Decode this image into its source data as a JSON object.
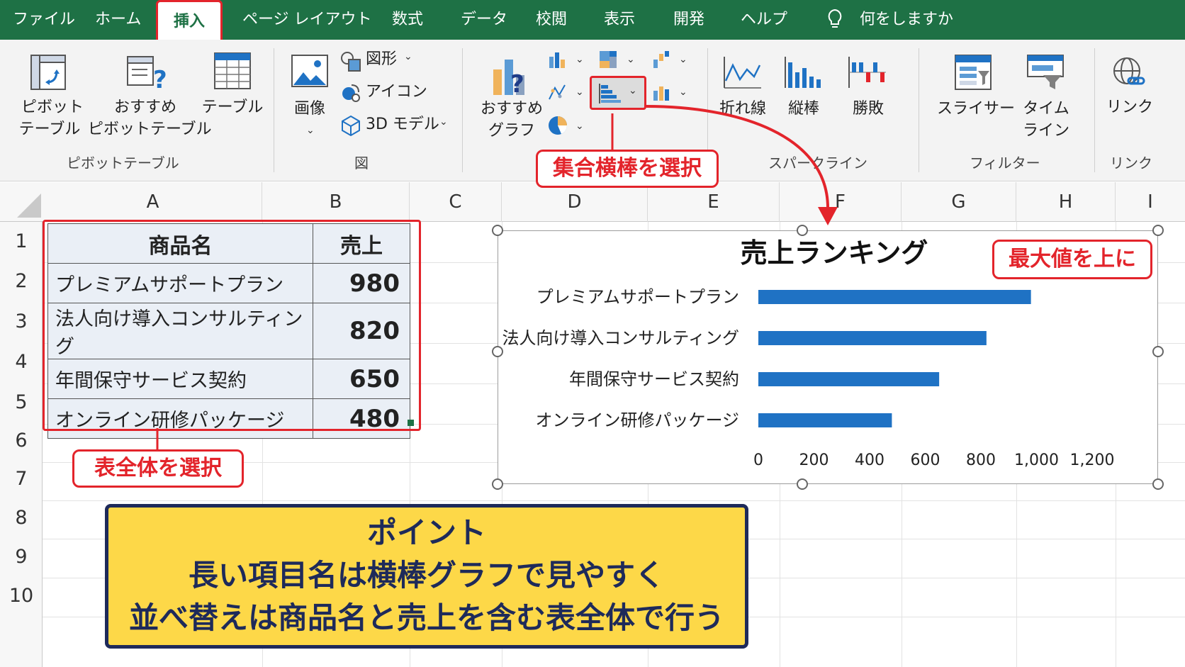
{
  "menu": {
    "items": [
      "ファイル",
      "ホーム",
      "挿入",
      "ページ レイアウト",
      "数式",
      "データ",
      "校閲",
      "表示",
      "開発",
      "ヘルプ"
    ],
    "active": "挿入",
    "tell_me": "何をしますか"
  },
  "ribbon": {
    "groups": {
      "pivot": {
        "label": "ピボットテーブル",
        "pivot_table": [
          "ピボット",
          "テーブル"
        ],
        "recommended_pivot": [
          "おすすめ",
          "ピボットテーブル"
        ],
        "table": "テーブル"
      },
      "illustrations": {
        "label": "図",
        "picture": "画像",
        "shapes": "図形",
        "icons": "アイコン",
        "models3d": "3D モデル"
      },
      "charts": {
        "recommended": [
          "おすすめ",
          "グラフ"
        ]
      },
      "sparklines": {
        "label": "スパークライン",
        "line": "折れ線",
        "column": "縦棒",
        "winloss": "勝敗"
      },
      "filters": {
        "label": "フィルター",
        "slicer": "スライサー",
        "timeline": [
          "タイム",
          "ライン"
        ]
      },
      "links": {
        "label": "リンク",
        "link": "リンク"
      }
    }
  },
  "columns": [
    "A",
    "B",
    "C",
    "D",
    "E",
    "F",
    "G",
    "H",
    "I"
  ],
  "rows": [
    "1",
    "2",
    "3",
    "4",
    "5",
    "6",
    "7",
    "8",
    "9",
    "10"
  ],
  "table": {
    "headers": [
      "商品名",
      "売上"
    ],
    "rows": [
      [
        "プレミアムサポートプラン",
        "980"
      ],
      [
        "法人向け導入コンサルティング",
        "820"
      ],
      [
        "年間保守サービス契約",
        "650"
      ],
      [
        "オンライン研修パッケージ",
        "480"
      ]
    ]
  },
  "callouts": {
    "select_bar": "集合横棒を選択",
    "select_table": "表全体を選択",
    "max_top": "最大値を上に"
  },
  "point": {
    "title": "ポイント",
    "line1": "長い項目名は横棒グラフで見やすく",
    "line2": "並べ替えは商品名と売上を含む表全体で行う"
  },
  "chart_data": {
    "type": "bar",
    "orientation": "horizontal",
    "title": "売上ランキング",
    "categories": [
      "プレミアムサポートプラン",
      "法人向け導入コンサルティング",
      "年間保守サービス契約",
      "オンライン研修パッケージ"
    ],
    "values": [
      980,
      820,
      650,
      480
    ],
    "xlim": [
      0,
      1200
    ],
    "ticks": [
      "0",
      "200",
      "400",
      "600",
      "800",
      "1,000",
      "1,200"
    ],
    "bar_color": "#1f72c4",
    "grid": false,
    "legend": "none"
  },
  "colors": {
    "excel_green": "#1e7145",
    "highlight_red": "#e3242b",
    "point_yellow": "#fdd848",
    "point_navy": "#1e2a5a"
  }
}
